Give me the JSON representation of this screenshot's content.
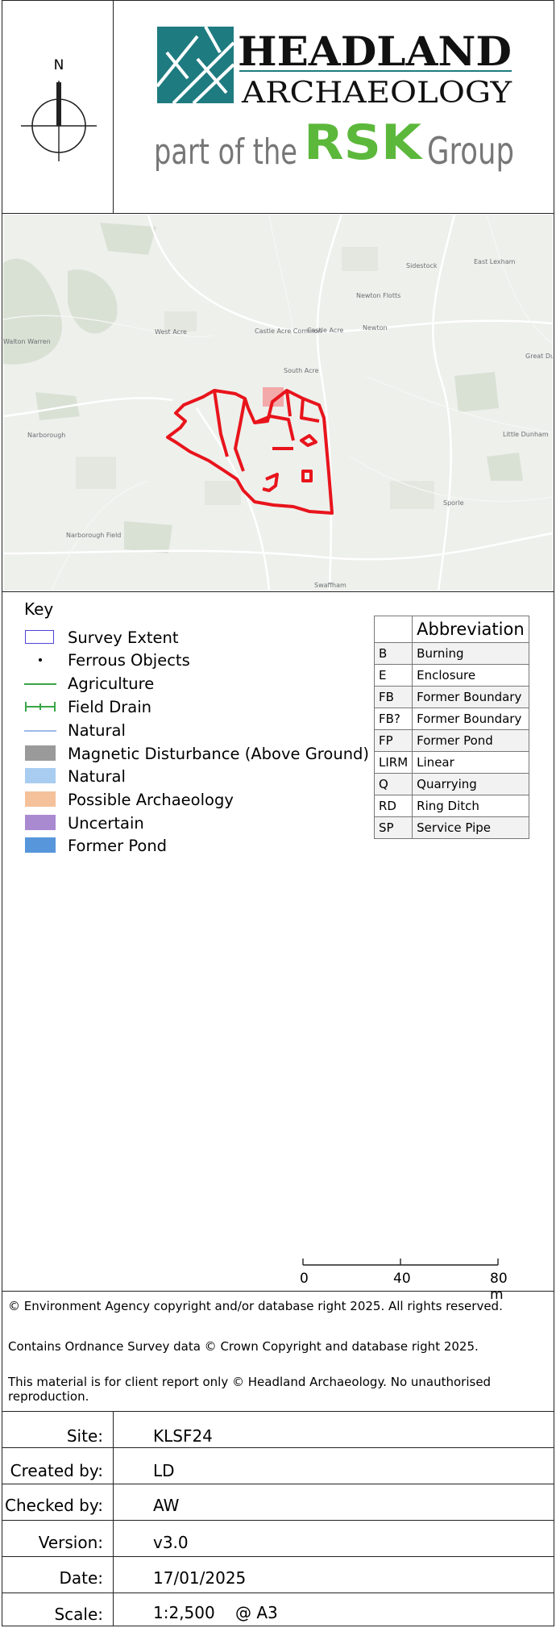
{
  "header": {
    "compass_label": "N",
    "logo_name_line1": "HEADLAND",
    "logo_name_line2": "ARCHAEOLOGY",
    "logo_part_of": "part of the",
    "logo_group_mark": "RSK",
    "logo_group_word": "Group",
    "colors": {
      "teal": "#1e7b80",
      "green": "#5cb83b",
      "grey": "#777777"
    }
  },
  "map": {
    "places": [
      "Sidestock",
      "East Lexham",
      "Newton Flotts",
      "West Acre",
      "Castle Acre Common",
      "Castle Acre",
      "Newton",
      "Great Du",
      "Walton Warren",
      "South Acre",
      "Narborough",
      "Little Dunham",
      "Sporle",
      "Narborough Field",
      "Swaffham"
    ]
  },
  "key": {
    "title": "Key",
    "items": [
      {
        "label": "Survey Extent",
        "color": "#4b45d8"
      },
      {
        "label": "Ferrous Objects",
        "color": "#000000"
      },
      {
        "label": "Agriculture",
        "color": "#3aa545"
      },
      {
        "label": "Field Drain",
        "color": "#3aa545"
      },
      {
        "label": "Natural",
        "color": "#9dbbe8"
      },
      {
        "label": "Magnetic Disturbance (Above Ground)",
        "color": "#9a9a9a"
      },
      {
        "label": "Natural",
        "color": "#a9cdf1"
      },
      {
        "label": "Possible Archaeology",
        "color": "#f5c19b"
      },
      {
        "label": "Uncertain",
        "color": "#a98ad1"
      },
      {
        "label": "Former Pond",
        "color": "#5796db"
      }
    ]
  },
  "abbreviations": {
    "header": "Abbreviation",
    "rows": [
      {
        "code": "B",
        "desc": "Burning"
      },
      {
        "code": "E",
        "desc": "Enclosure"
      },
      {
        "code": "FB",
        "desc": "Former Boundary"
      },
      {
        "code": "FB?",
        "desc": "Former Boundary"
      },
      {
        "code": "FP",
        "desc": "Former Pond"
      },
      {
        "code": "LIRM",
        "desc": "Linear"
      },
      {
        "code": "Q",
        "desc": "Quarrying"
      },
      {
        "code": "RD",
        "desc": "Ring Ditch"
      },
      {
        "code": "SP",
        "desc": "Service Pipe"
      }
    ]
  },
  "scale_bar": {
    "labels": [
      "0",
      "40",
      "80 m"
    ]
  },
  "copyright": [
    "© Environment Agency copyright and/or database right 2025. All rights reserved.",
    "Contains Ordnance Survey data © Crown Copyright and database right 2025.",
    "This material is for client report only © Headland Archaeology. No unauthorised reproduction."
  ],
  "info": {
    "site_label": "Site:",
    "site_value": "KLSF24",
    "created_label": "Created by:",
    "created_value": "LD",
    "checked_label": "Checked by:",
    "checked_value": "AW",
    "version_label": "Version:",
    "version_value": "v3.0",
    "date_label": "Date:",
    "date_value": "17/01/2025",
    "scale_label": "Scale:",
    "scale_value": "1:2,500",
    "paper_value": "@ A3"
  }
}
